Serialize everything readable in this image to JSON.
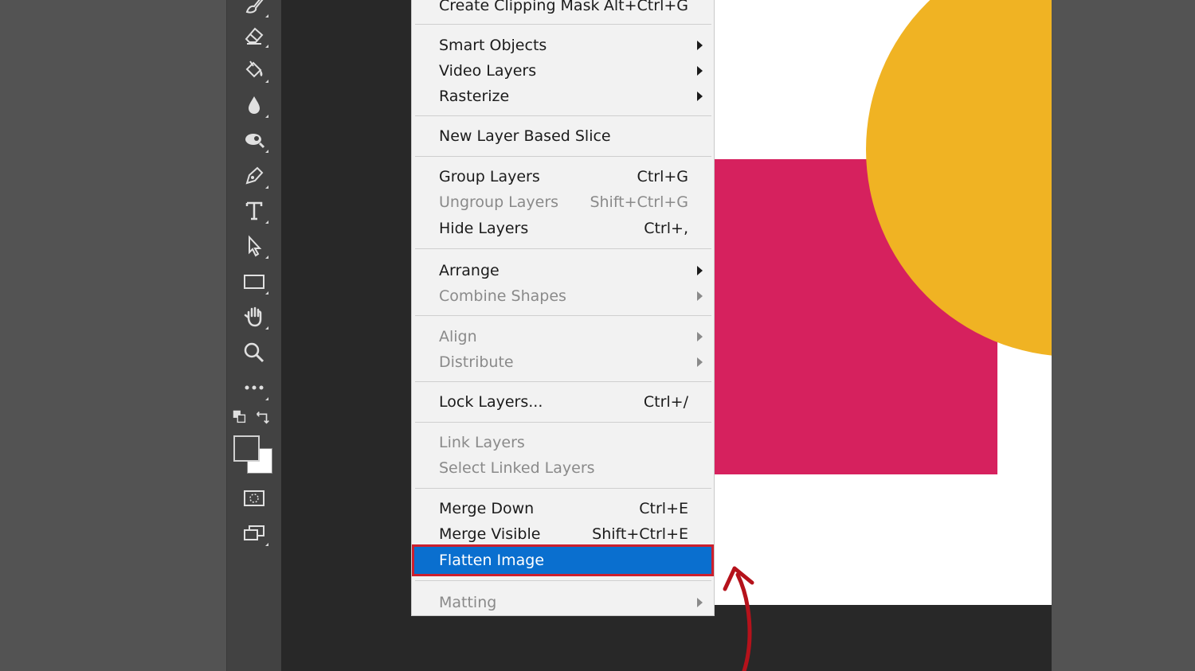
{
  "colors": {
    "menu_highlight": "#0a6fcf",
    "highlight_border": "#cc1f2d",
    "annotation_arrow": "#b5121b",
    "shape_pink": "#d6215e",
    "shape_yellow": "#f0b323"
  },
  "toolbar": {
    "tools": [
      "brush-icon",
      "eraser-icon",
      "paint-bucket-icon",
      "blur-drop-icon",
      "dodge-icon",
      "pen-icon",
      "type-icon",
      "path-selection-icon",
      "rectangle-icon",
      "hand-icon",
      "zoom-icon",
      "more-tools-icon",
      "swap-colors-icon",
      "color-swatches",
      "quick-mask-icon",
      "screen-mode-icon"
    ]
  },
  "menu": {
    "partial_item": {
      "label": "Create Clipping Mask",
      "shortcut": "Alt+Ctrl+G"
    },
    "items": [
      {
        "label": "Smart Objects",
        "submenu": true
      },
      {
        "label": "Video Layers",
        "submenu": true
      },
      {
        "label": "Rasterize",
        "submenu": true
      },
      {
        "label": "New Layer Based Slice"
      },
      {
        "label": "Group Layers",
        "shortcut": "Ctrl+G"
      },
      {
        "label": "Ungroup Layers",
        "shortcut": "Shift+Ctrl+G",
        "disabled": true
      },
      {
        "label": "Hide Layers",
        "shortcut": "Ctrl+,"
      },
      {
        "label": "Arrange",
        "submenu": true
      },
      {
        "label": "Combine Shapes",
        "submenu": true,
        "disabled": true
      },
      {
        "label": "Align",
        "submenu": true,
        "disabled": true
      },
      {
        "label": "Distribute",
        "submenu": true,
        "disabled": true
      },
      {
        "label": "Lock Layers...",
        "shortcut": "Ctrl+/"
      },
      {
        "label": "Link Layers",
        "disabled": true
      },
      {
        "label": "Select Linked Layers",
        "disabled": true
      },
      {
        "label": "Merge Down",
        "shortcut": "Ctrl+E"
      },
      {
        "label": "Merge Visible",
        "shortcut": "Shift+Ctrl+E"
      },
      {
        "label": "Flatten Image",
        "selected": true
      },
      {
        "label": "Matting",
        "submenu": true,
        "disabled": true
      }
    ]
  }
}
